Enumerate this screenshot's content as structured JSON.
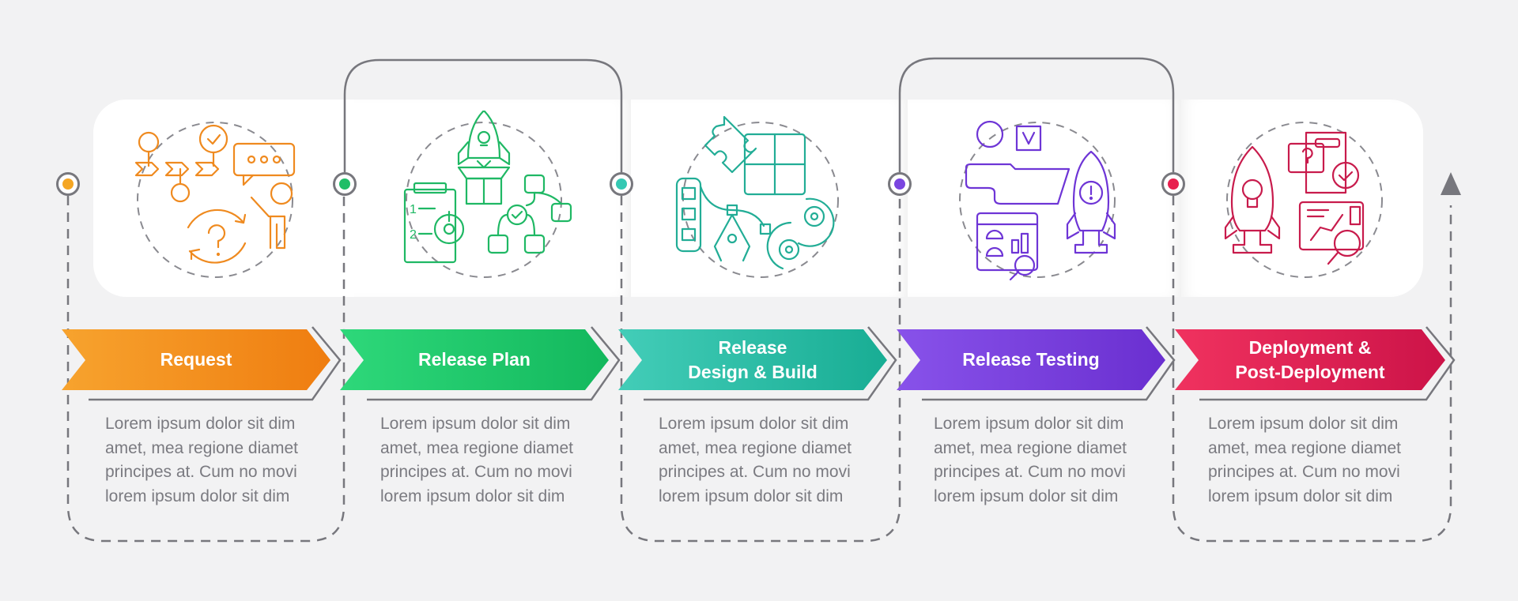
{
  "steps": [
    {
      "title": "Request",
      "description": "Lorem ipsum dolor sit dim amet, mea regione diamet principes at. Cum no movi lorem ipsum dolor sit dim",
      "color_start": "#f7a32e",
      "color_end": "#ef7d10",
      "dot_color": "#f5a623",
      "icon": "request-workflow-icon"
    },
    {
      "title": "Release Plan",
      "description": "Lorem ipsum dolor sit dim amet, mea regione diamet principes at. Cum no movi lorem ipsum dolor sit dim",
      "color_start": "#2ed87a",
      "color_end": "#13b85d",
      "dot_color": "#1fbe67",
      "icon": "release-plan-icon"
    },
    {
      "title": "Release\nDesign & Build",
      "description": "Lorem ipsum dolor sit dim amet, mea regione diamet principes at. Cum no movi lorem ipsum dolor sit dim",
      "color_start": "#43cdb8",
      "color_end": "#18ad94",
      "dot_color": "#35c8b3",
      "icon": "design-build-icon"
    },
    {
      "title": "Release Testing",
      "description": "Lorem ipsum dolor sit dim amet, mea regione diamet principes at. Cum no movi lorem ipsum dolor sit dim",
      "color_start": "#8852ea",
      "color_end": "#6a2fd0",
      "dot_color": "#7a45e0",
      "icon": "release-testing-icon"
    },
    {
      "title": "Deployment &\nPost-Deployment",
      "description": "Lorem ipsum dolor sit dim amet, mea regione diamet principes at. Cum no movi lorem ipsum dolor sit dim",
      "color_start": "#f0325f",
      "color_end": "#cc1348",
      "dot_color": "#e8204f",
      "icon": "deployment-icon"
    }
  ],
  "line_color": "#77777d",
  "end_marker": "triangle-up-icon"
}
